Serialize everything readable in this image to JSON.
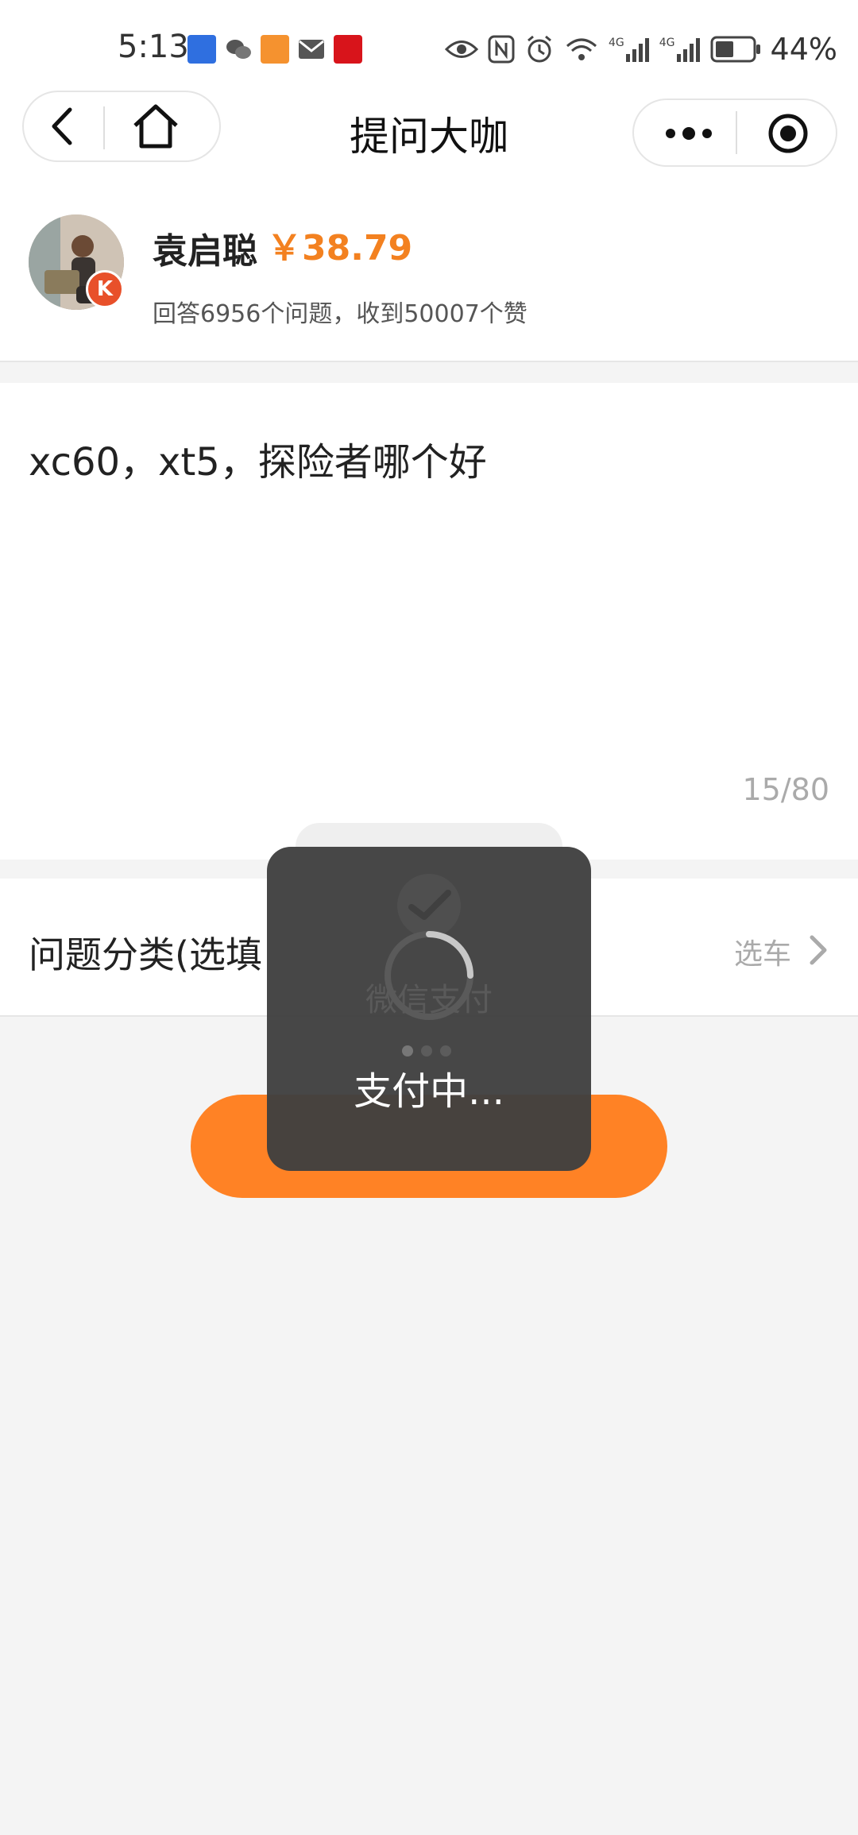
{
  "status_bar": {
    "time": "5:13",
    "network_1": "4G",
    "network_2": "4G",
    "battery": "44%",
    "icons": [
      "hejia-icon",
      "wechat-icon",
      "chat-bubble-icon",
      "mail-icon",
      "red-app-icon",
      "eye-icon",
      "nfc-icon",
      "alarm-icon",
      "wifi-icon",
      "signal-icon",
      "signal-icon",
      "battery-icon"
    ]
  },
  "nav": {
    "title": "提问大咖",
    "icons": [
      "back-icon",
      "home-icon",
      "more-icon",
      "close-target-icon"
    ]
  },
  "expert": {
    "name": "袁启聪",
    "price": "￥38.79",
    "stats": "回答6956个问题，收到50007个赞",
    "badge": "K"
  },
  "question": {
    "text": "xc60，xt5，探险者哪个好",
    "char_count": "15/80"
  },
  "category": {
    "label": "问题分类(选填",
    "value": "选车"
  },
  "payment_overlay": {
    "wechat_pay_label": "微信支付",
    "loading_text": "支付中..."
  },
  "colors": {
    "accent": "#ff8225",
    "price": "#f38120",
    "toast": "#404040"
  }
}
